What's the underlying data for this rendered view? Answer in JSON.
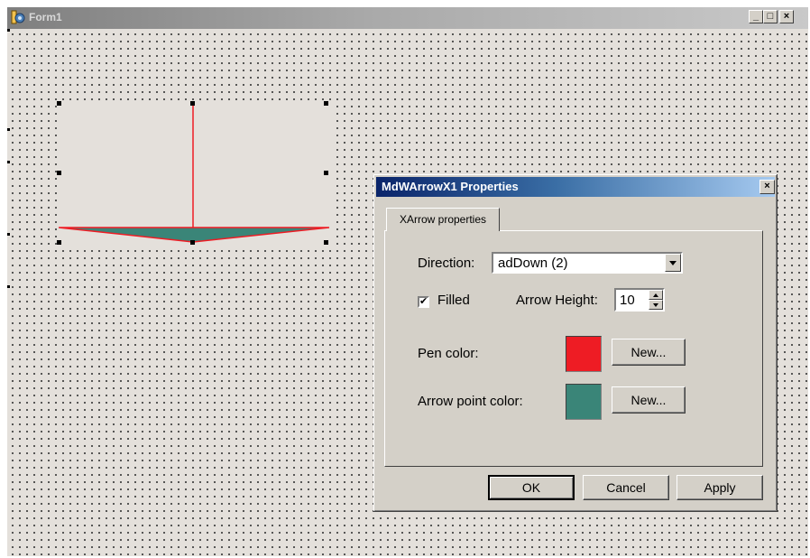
{
  "form": {
    "title": "Form1",
    "icon": "delphi-form-icon",
    "caption_buttons": {
      "minimize": "_",
      "maximize": "□",
      "close": "×"
    }
  },
  "arrow_control": {
    "direction": "down",
    "colors": {
      "pen": "#ee1c24",
      "fill": "#3a8578",
      "background": "#e4e0db"
    }
  },
  "dialog": {
    "title": "MdWArrowX1 Properties",
    "close_label": "×",
    "tab_label": "XArrow properties",
    "direction_label": "Direction:",
    "direction_value": "adDown (2)",
    "filled_label": "Filled",
    "filled_checked": true,
    "filled_mark": "✔",
    "arrow_height_label": "Arrow Height:",
    "arrow_height_value": "10",
    "pen_color_label": "Pen color:",
    "pen_color": "#ee1c24",
    "arrow_point_color_label": "Arrow point color:",
    "arrow_point_color": "#3a8578",
    "new_button_label": "New...",
    "ok_label": "OK",
    "cancel_label": "Cancel",
    "apply_label": "Apply"
  }
}
